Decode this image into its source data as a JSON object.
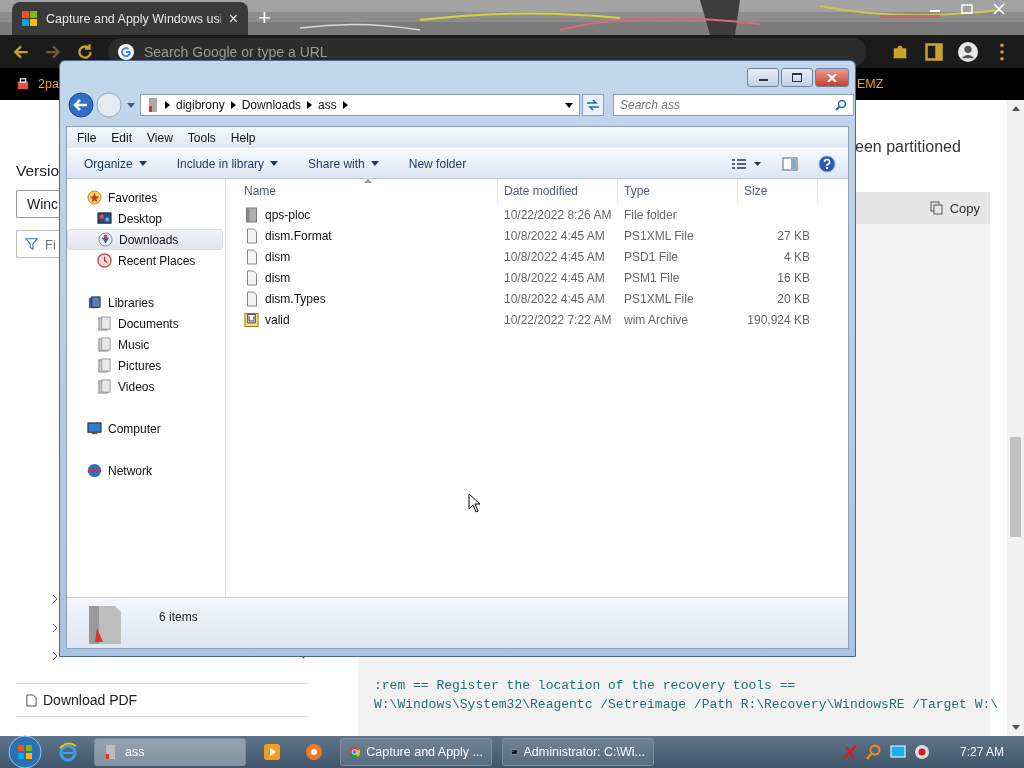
{
  "browser": {
    "tab": {
      "title": "Capture and Apply Windows usi",
      "close": "×"
    },
    "new_tab": "+",
    "address": {
      "placeholder": "Search Google or type a URL"
    },
    "bookmarks": [
      "2pa",
      "EMZ"
    ]
  },
  "page": {
    "heading": "Versio",
    "version_select": "Winc",
    "filter_placeholder": "Fi",
    "download": "Download PDF",
    "intro": "een partitioned",
    "copy": "Copy",
    "code_lines": [
      ":rem == Register the location of the recovery tools ==",
      "W:\\Windows\\System32\\Reagentc /Setreimage /Path R:\\Recovery\\WindowsRE /Target W:\\"
    ]
  },
  "explorer": {
    "breadcrumb": [
      "digibrony",
      "Downloads",
      "ass"
    ],
    "search": {
      "placeholder": "Search ass"
    },
    "menu": [
      "File",
      "Edit",
      "View",
      "Tools",
      "Help"
    ],
    "toolbar": [
      {
        "label": "Organize",
        "dropdown": true
      },
      {
        "label": "Include in library",
        "dropdown": true
      },
      {
        "label": "Share with",
        "dropdown": true
      },
      {
        "label": "New folder",
        "dropdown": false
      }
    ],
    "nav": [
      {
        "label": "Favorites",
        "kind": "favorites",
        "selected": false,
        "children": [
          {
            "label": "Desktop",
            "kind": "desktop",
            "selected": false
          },
          {
            "label": "Downloads",
            "kind": "downloads",
            "selected": true
          },
          {
            "label": "Recent Places",
            "kind": "recent",
            "selected": false
          }
        ]
      },
      {
        "label": "Libraries",
        "kind": "libraries",
        "selected": false,
        "children": [
          {
            "label": "Documents",
            "kind": "library",
            "selected": false
          },
          {
            "label": "Music",
            "kind": "library",
            "selected": false
          },
          {
            "label": "Pictures",
            "kind": "library",
            "selected": false
          },
          {
            "label": "Videos",
            "kind": "library",
            "selected": false
          }
        ]
      },
      {
        "label": "Computer",
        "kind": "computer",
        "selected": false
      },
      {
        "label": "Network",
        "kind": "network",
        "selected": false
      }
    ],
    "columns": [
      "Name",
      "Date modified",
      "Type",
      "Size"
    ],
    "files": [
      {
        "name": "qps-ploc",
        "date": "10/22/2022 8:26 AM",
        "type": "File folder",
        "kind": "folder"
      },
      {
        "name": "dism.Format",
        "date": "10/8/2022 4:45 AM",
        "type": "PS1XML File",
        "size": "27 KB",
        "kind": "document"
      },
      {
        "name": "dism",
        "date": "10/8/2022 4:45 AM",
        "type": "PSD1 File",
        "size": "4 KB",
        "kind": "document"
      },
      {
        "name": "dism",
        "date": "10/8/2022 4:45 AM",
        "type": "PSM1 File",
        "size": "16 KB",
        "kind": "document"
      },
      {
        "name": "dism.Types",
        "date": "10/8/2022 4:45 AM",
        "type": "PS1XML File",
        "size": "20 KB",
        "kind": "document"
      },
      {
        "name": "valid",
        "date": "10/22/2022 7:22 AM",
        "type": "wim Archive",
        "size": "190,924 KB",
        "kind": "archive"
      }
    ],
    "status": "6 items"
  },
  "taskbar": {
    "items": [
      {
        "kind": "ie"
      },
      {
        "kind": "explorer",
        "label": "ass",
        "active": true
      },
      {
        "kind": "media"
      },
      {
        "kind": "app"
      },
      {
        "kind": "chrome",
        "label": "Capture and Apply ...",
        "active": false
      },
      {
        "kind": "cmd",
        "label": "Administrator: C:\\Wi...",
        "active": false
      }
    ],
    "clock": "7:27 AM"
  }
}
